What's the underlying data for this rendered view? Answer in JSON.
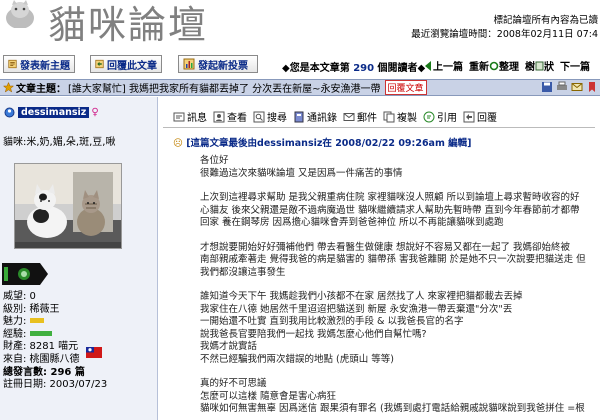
{
  "header": {
    "logo_text": "貓咪論壇",
    "rights_line": "標記論壇所有內容為已讀",
    "last_visit_line": "最近瀏覽論壇時間：2008年02月11日 07:4"
  },
  "toolbar": {
    "new_topic": "發表新主題",
    "reply": "回覆此文章",
    "new_poll": "發起新投票",
    "views_prefix": "◆您是本文章第",
    "views_count": "290",
    "views_suffix": "個閱讀者◆",
    "prev": "上一篇",
    "refresh": "重新",
    "organize": "整理",
    "tree": "樹",
    "forum_short": "狀",
    "next": "下一篇"
  },
  "subject": {
    "label": "文章主題：",
    "text": "[誰大家幫忙] 我媽把我家所有貓都丟掉了 分次丟在新屋~永安漁港一帶",
    "tag": "回覆文章"
  },
  "user": {
    "name": "dessimansiz",
    "gender": "♀",
    "desc": "貓咪:米,奶,媚,朵,斑,豆,啾",
    "stats": [
      "威望: 0",
      "級別: 稀薇王",
      "魅力:",
      "經驗:",
      "財產: 8281 喵元",
      "來自: 桃園縣八德",
      "總發言數: 296 篇",
      "註冊日期: 2003/07/23"
    ]
  },
  "post_tools": [
    "訊息",
    "查看",
    "搜尋",
    "通訊錄",
    "郵件",
    "複製",
    "引用",
    "回覆"
  ],
  "post": {
    "face": "☹",
    "meta": "[這篇文章最後由dessimansiz在 2008/02/22 09:26am 編輯]",
    "body": [
      "各位好",
      "很難過這次來貓咪論壇 又是因爲一件痛苦的事情",
      "",
      "上次到這裡尋求幫助 是我父親重病住院 家裡貓咪沒人照顧 所以到論壇上尋求暫時收容的好",
      "心貓友 後來父親還是敵不過病魔過世 貓咪繼續請求人幫助先暫時帶 直到今年春節前才都帶",
      "回家 養在鋼琴房 因爲擔心貓咪會弄到爸爸神位 所以不再能讓貓咪到處跑",
      "",
      "才想說要開始好好彌補他們 帶去看醫生做健康 想說好不容易又都在一起了 我媽卻始終被",
      "南部親戚牽著走 覺得我爸的病是貓害的 貓帶孫 害我爸離開 於是她不只一次說要把貓送走 但",
      "我們都沒讓這事發生",
      "",
      "誰知道今天下午 我媽趁我們小孩都不在家 居然找了人 來家裡把貓都載去丟掉",
      "我家住在八德 她居然千里迢迢把貓送到 新屋 永安漁港一帶丟棄還\"分次\"丟",
      "一開始還不吐實 直到我用比較激烈的手段 & 以我爸長官的名字",
      "說我爸長官要陪我們一起找 我媽怎麼心他們自幫忙嗎?",
      "我媽才說實話",
      "不然已經騙我們兩次錯誤的地點 (虎頭山 等等)",
      "",
      "真的好不可思議",
      "怎麼可以這樣 隨意會是害心病狂",
      "貓咪如何無害無辜 因爲迷信 跟果須有罪名 (我媽到處打電話給親戚說貓咪說到我爸拼住 =根"
    ]
  },
  "colors": {
    "accent": "#0a2a88",
    "subject_bar": "#c9d2e6",
    "sidebar": "#eef1f8"
  }
}
